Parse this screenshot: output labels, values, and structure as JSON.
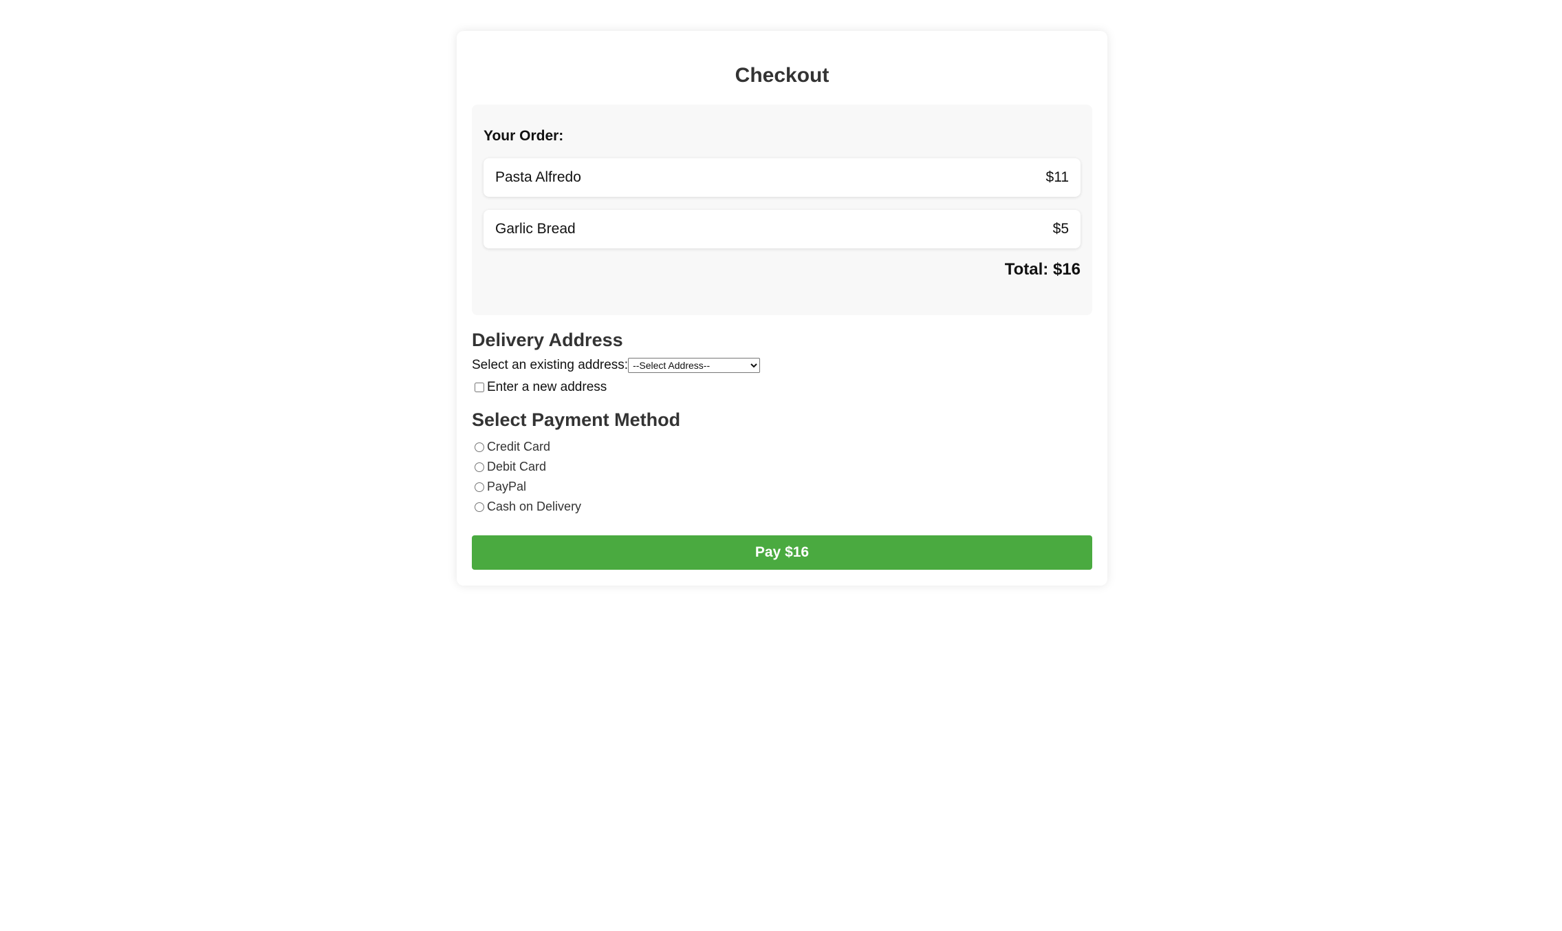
{
  "page": {
    "title": "Checkout"
  },
  "order": {
    "heading": "Your Order:",
    "items": [
      {
        "name": "Pasta Alfredo",
        "price": "$11"
      },
      {
        "name": "Garlic Bread",
        "price": "$5"
      }
    ],
    "total": "Total: $16"
  },
  "delivery": {
    "heading": "Delivery Address",
    "select_label": "Select an existing address:",
    "select_value": "--Select Address--",
    "new_address_label": "Enter a new address"
  },
  "payment": {
    "heading": "Select Payment Method",
    "options": [
      {
        "label": "Credit Card"
      },
      {
        "label": "Debit Card"
      },
      {
        "label": "PayPal"
      },
      {
        "label": "Cash on Delivery"
      }
    ]
  },
  "actions": {
    "pay_label": "Pay $16"
  },
  "colors": {
    "pay_button": "#4aaa40",
    "order_box_bg": "#f8f8f8"
  }
}
